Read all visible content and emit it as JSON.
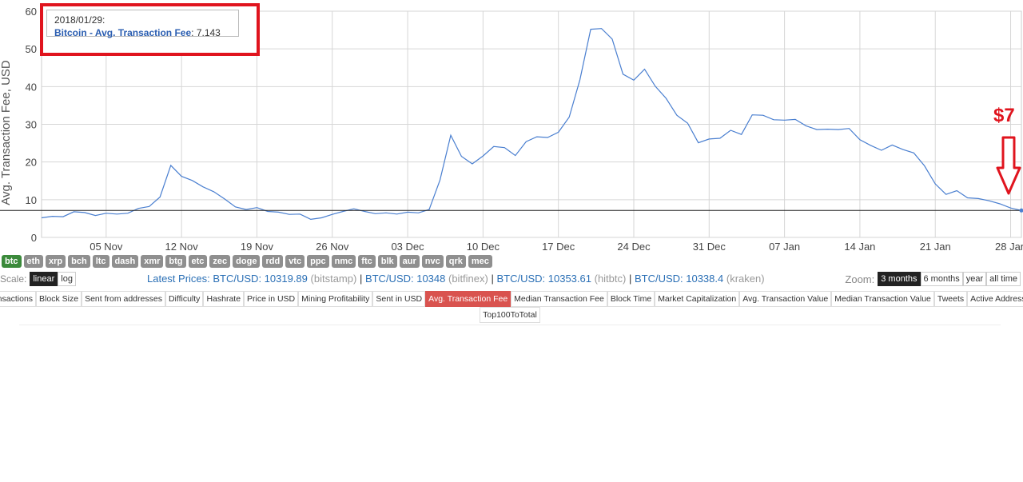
{
  "chart_data": {
    "type": "line",
    "ylabel": "Avg. Transaction Fee, USD",
    "ylim": [
      0,
      60
    ],
    "yticks": [
      "0",
      "10",
      "20",
      "30",
      "40",
      "50",
      "60"
    ],
    "xtick_labels": [
      "05 Nov",
      "12 Nov",
      "19 Nov",
      "26 Nov",
      "03 Dec",
      "10 Dec",
      "17 Dec",
      "24 Dec",
      "31 Dec",
      "07 Jan",
      "14 Jan",
      "21 Jan",
      "28 Jan"
    ],
    "x_start": "2017-10-30",
    "x_end": "2018-01-29",
    "grid": true,
    "reference_value": 7.143,
    "series": [
      {
        "color": "#4a7fd0",
        "values": [
          5.2,
          5.6,
          5.5,
          6.8,
          6.6,
          5.8,
          6.4,
          6.2,
          6.4,
          7.7,
          8.2,
          10.7,
          19.1,
          16.2,
          15.1,
          13.4,
          12.1,
          10.2,
          8.1,
          7.4,
          7.9,
          6.9,
          6.7,
          6.1,
          6.2,
          4.8,
          5.2,
          6.1,
          6.9,
          7.6,
          6.9,
          6.3,
          6.5,
          6.2,
          6.7,
          6.5,
          7.4,
          15.2,
          27.1,
          21.5,
          19.5,
          21.6,
          24.1,
          23.8,
          21.7,
          25.4,
          26.7,
          26.5,
          27.9,
          31.9,
          41.8,
          55.2,
          55.4,
          52.6,
          43.3,
          41.7,
          44.6,
          40.1,
          36.9,
          32.4,
          30.3,
          25.1,
          26.1,
          26.3,
          28.4,
          27.3,
          32.5,
          32.4,
          31.2,
          31.1,
          31.3,
          29.6,
          28.6,
          28.7,
          28.6,
          28.9,
          25.9,
          24.4,
          23.1,
          24.5,
          23.3,
          22.4,
          19.0,
          14.2,
          11.4,
          12.4,
          10.5,
          10.3,
          9.7,
          8.9,
          7.8,
          7.143
        ]
      }
    ]
  },
  "tooltip": {
    "date": "2018/01/29:",
    "series_name": "Bitcoin - Avg. Transaction Fee",
    "value": "7.143"
  },
  "annotation": {
    "price_label": "$7"
  },
  "coins": [
    "btc",
    "eth",
    "xrp",
    "bch",
    "ltc",
    "dash",
    "xmr",
    "btg",
    "etc",
    "zec",
    "doge",
    "rdd",
    "vtc",
    "ppc",
    "nmc",
    "ftc",
    "blk",
    "aur",
    "nvc",
    "qrk",
    "mec"
  ],
  "scale": {
    "label": "Scale:",
    "linear": "linear",
    "log": "log"
  },
  "prices": {
    "intro": "Latest Prices:",
    "items": [
      {
        "pair": "BTC/USD: 10319.89",
        "source": "(bitstamp)"
      },
      {
        "pair": "BTC/USD: 10348",
        "source": "(bitfinex)"
      },
      {
        "pair": "BTC/USD: 10353.61",
        "source": "(hitbtc)"
      },
      {
        "pair": "BTC/USD: 10338.4",
        "source": "(kraken)"
      }
    ]
  },
  "zoom": {
    "label": "Zoom:",
    "options": [
      "3 months",
      "6 months",
      "year",
      "all time"
    ]
  },
  "metrics": {
    "row1": [
      "Transactions",
      "Block Size",
      "Sent from addresses",
      "Difficulty",
      "Hashrate",
      "Price in USD",
      "Mining Profitability",
      "Sent in USD",
      "Avg. Transaction Fee",
      "Median Transaction Fee",
      "Block Time",
      "Market Capitalization",
      "Avg. Transaction Value",
      "Median Transaction Value",
      "Tweets",
      "Active Addresses"
    ],
    "row2": [
      "Top100ToTotal"
    ],
    "active": "Avg. Transaction Fee"
  }
}
